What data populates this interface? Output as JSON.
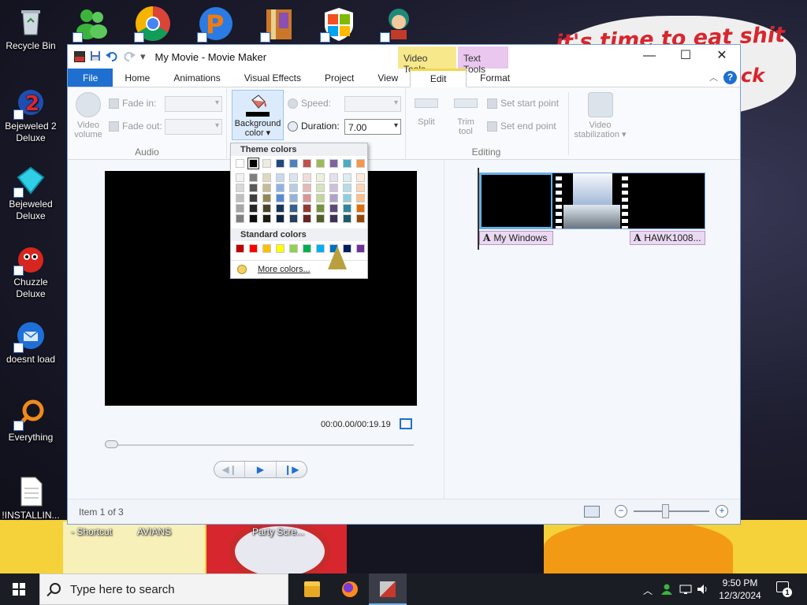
{
  "desktop": {
    "graffiti_text": "it's time to eat shit",
    "graffiti_text_2": "ck",
    "icons": [
      {
        "label": "Recycle Bin",
        "icon": "recycle-bin-icon"
      },
      {
        "label": "Bejeweled 2 Deluxe",
        "icon": "bejeweled-2-icon"
      },
      {
        "label": "Bejeweled Deluxe",
        "icon": "bejeweled-icon"
      },
      {
        "label": "Chuzzle Deluxe",
        "icon": "chuzzle-icon"
      },
      {
        "label": "doesnt load",
        "icon": "thunderbird-icon"
      },
      {
        "label": "Everything",
        "icon": "everything-search-icon"
      },
      {
        "label": "!INSTALLIN...",
        "icon": "text-file-icon"
      }
    ],
    "top_icons": [
      "messenger-icon",
      "chrome-icon",
      "popcap-icon",
      "winrar-icon",
      "windows-shield-icon",
      "game-character-icon"
    ],
    "background_labels": [
      "- Shortcut",
      "AVIANS",
      "Party Scre..."
    ]
  },
  "window": {
    "title": "My Movie - Movie Maker",
    "tool_tabs": {
      "video": "Video Tools",
      "text": "Text Tools"
    },
    "tabs": [
      "File",
      "Home",
      "Animations",
      "Visual Effects",
      "Project",
      "View",
      "Edit",
      "Format"
    ],
    "help": "?",
    "controls": {
      "minimize": "—",
      "maximize": "☐",
      "close": "✕"
    }
  },
  "ribbon": {
    "audio": {
      "label": "Audio",
      "video_volume": "Video volume",
      "fade_in": "Fade in:",
      "fade_out": "Fade out:"
    },
    "adjust": {
      "background_color": "Background color ▾",
      "speed": "Speed:",
      "duration": "Duration:",
      "duration_value": "7.00"
    },
    "editing": {
      "label": "Editing",
      "split": "Split",
      "trim_tool": "Trim tool",
      "set_start_point": "Set start point",
      "set_end_point": "Set end point",
      "video_stabilization": "Video stabilization ▾"
    }
  },
  "color_menu": {
    "theme_header": "Theme colors",
    "standard_header": "Standard colors",
    "more_colors": "More colors...",
    "theme_top_row": [
      "#ffffff",
      "#000000",
      "#eeece1",
      "#1f497d",
      "#4f81bd",
      "#c0504d",
      "#9bbb59",
      "#8064a2",
      "#4bacc6",
      "#f79646"
    ],
    "theme_columns": [
      [
        "#f2f2f2",
        "#d8d8d8",
        "#bfbfbf",
        "#a5a5a5",
        "#7f7f7f"
      ],
      [
        "#7f7f7f",
        "#595959",
        "#3f3f3f",
        "#262626",
        "#0c0c0c"
      ],
      [
        "#ddd9c3",
        "#c4bd97",
        "#938953",
        "#494429",
        "#1d1b10"
      ],
      [
        "#c6d9f0",
        "#8db3e2",
        "#548dd4",
        "#17365d",
        "#0f243e"
      ],
      [
        "#dbe5f1",
        "#b8cce4",
        "#95b3d7",
        "#366092",
        "#244061"
      ],
      [
        "#f2dcdb",
        "#e5b9b7",
        "#d99694",
        "#953734",
        "#632423"
      ],
      [
        "#ebf1dd",
        "#d7e3bc",
        "#c3d69b",
        "#76923c",
        "#4f6128"
      ],
      [
        "#e5e0ec",
        "#ccc1d9",
        "#b2a2c7",
        "#5f497a",
        "#3f3151"
      ],
      [
        "#dbeef3",
        "#b7dde8",
        "#92cddc",
        "#31859b",
        "#205867"
      ],
      [
        "#fdeada",
        "#fbd5b5",
        "#fac08f",
        "#e36c09",
        "#974806"
      ]
    ],
    "standard_row": [
      "#c00000",
      "#ff0000",
      "#ffc000",
      "#ffff00",
      "#92d050",
      "#00b050",
      "#00b0f0",
      "#0070c0",
      "#002060",
      "#7030a0"
    ]
  },
  "preview": {
    "timecode": "00:00.00/00:19.19"
  },
  "storyboard": {
    "captions": [
      "My Windows",
      "HAWK1008..."
    ]
  },
  "status": {
    "item_text": "Item 1 of 3"
  },
  "taskbar": {
    "search_placeholder": "Type here to search",
    "time": "9:50 PM",
    "date": "12/3/2024",
    "notification_count": "1"
  }
}
